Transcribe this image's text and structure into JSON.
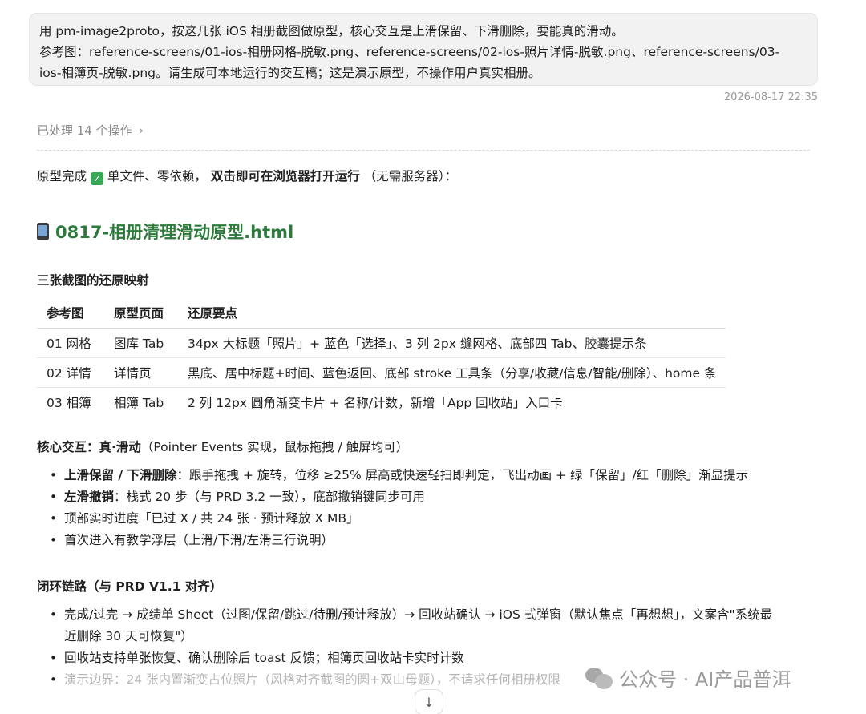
{
  "prompt": {
    "line1": "用 pm-image2proto，按这几张 iOS 相册截图做原型，核心交互是上滑保留、下滑删除，要能真的滑动。",
    "line2": "参考图：reference-screens/01-ios-相册网格-脱敏.png、reference-screens/02-ios-照片详情-脱敏.png、reference-screens/03-",
    "line3": "ios-相簿页-脱敏.png。请生成可本地运行的交互稿；这是演示原型，不操作用户真实相册。"
  },
  "timestamp": "2026-08-17 22:35",
  "processed": {
    "label": "已处理 14 个操作",
    "chevron": "›"
  },
  "intro": {
    "prefix": "原型完成",
    "check": "✓",
    "mid": " 单文件、零依赖，",
    "bold": "双击即可在浏览器打开运行",
    "suffix": "（无需服务器）："
  },
  "file_title": "0817-相册清理滑动原型.html",
  "section_mapping": {
    "title": "三张截图的还原映射",
    "headers": [
      "参考图",
      "原型页面",
      "还原要点"
    ],
    "rows": [
      [
        "01 网格",
        "图库 Tab",
        "34px 大标题「照片」+ 蓝色「选择」、3 列 2px 缝网格、底部四 Tab、胶囊提示条"
      ],
      [
        "02 详情",
        "详情页",
        "黑底、居中标题+时间、蓝色返回、底部 stroke 工具条（分享/收藏/信息/智能/删除）、home 条"
      ],
      [
        "03 相簿",
        "相簿 Tab",
        "2 列 12px 圆角渐变卡片 + 名称/计数，新增「App 回收站」入口卡"
      ]
    ]
  },
  "section_interaction": {
    "title_bold": "核心交互：真·滑动",
    "title_normal": "（Pointer Events 实现，鼠标拖拽 / 触屏均可）",
    "items": [
      {
        "bold": "上滑保留 / 下滑删除",
        "text": "：跟手拖拽 + 旋转，位移 ≥25% 屏高或快速轻扫即判定，飞出动画 + 绿「保留」/红「删除」渐显提示"
      },
      {
        "bold": "左滑撤销",
        "text": "：栈式 20 步（与 PRD 3.2 一致），底部撤销键同步可用"
      },
      {
        "bold": "",
        "text": "顶部实时进度「已过 X / 共 24 张 · 预计释放 X MB」"
      },
      {
        "bold": "",
        "text": "首次进入有教学浮层（上滑/下滑/左滑三行说明）"
      }
    ]
  },
  "section_loop": {
    "title": "闭环链路（与 PRD V1.1 对齐）",
    "items": [
      {
        "text1": "完成/过完 → 成绩单 Sheet（过图/保留/跳过/待删/预计释放）→ 回收站确认 → iOS 式弹窗（默认焦点「再想想」，文案含\"系统最",
        "text2": "近删除 30 天可恢复\"）"
      },
      {
        "text1": "回收站支持单张恢复、确认删除后 toast 反馈；相簿页回收站卡实时计数",
        "text2": ""
      },
      {
        "text1": "演示边界：24 张内置渐变占位照片（风格对齐截图的圆+双山母题），不请求任何相册权限",
        "text2": ""
      }
    ]
  },
  "watermark": "公众号 · AI产品普洱",
  "scroll_button": "↓"
}
